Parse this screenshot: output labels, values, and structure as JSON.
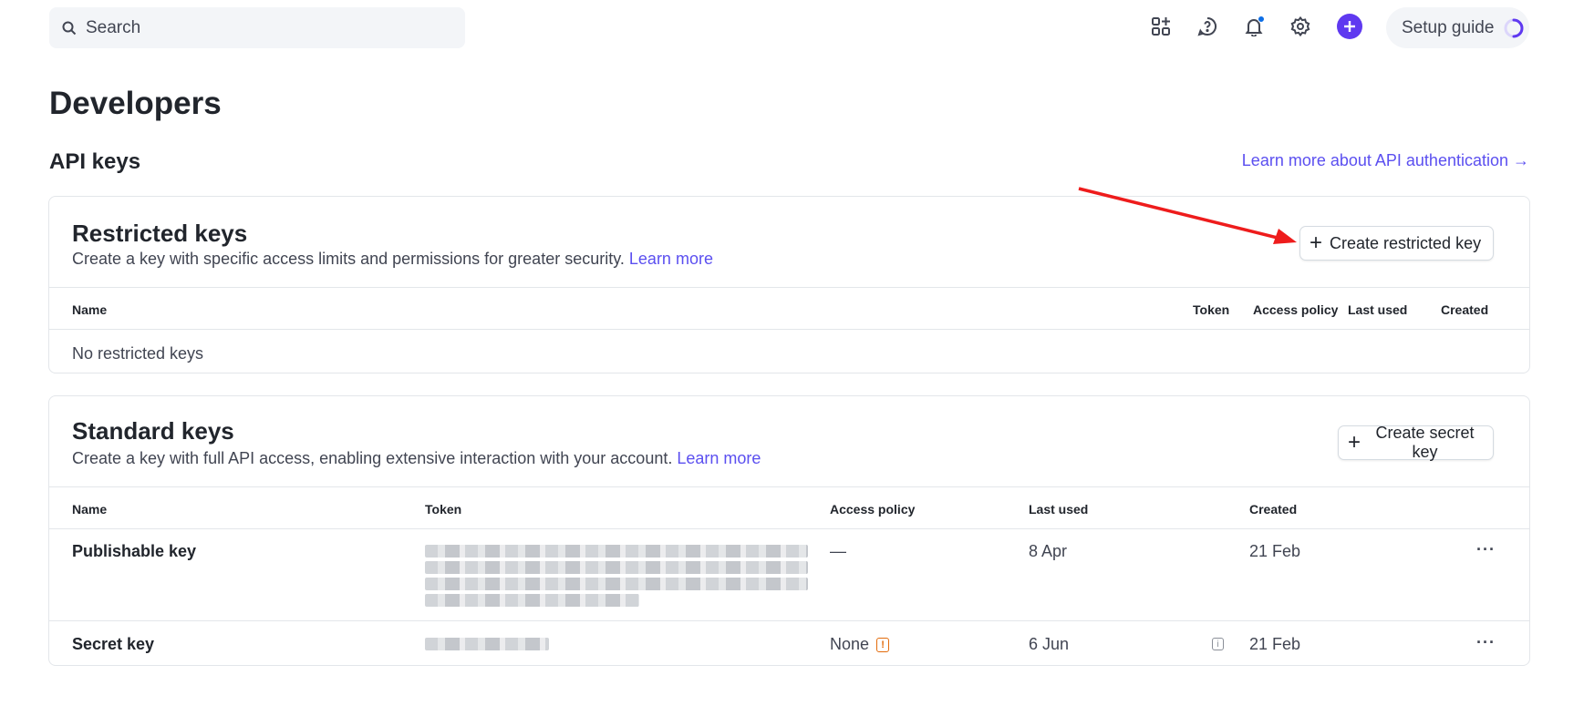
{
  "search": {
    "placeholder": "Search"
  },
  "topbar": {
    "icons": [
      "apps-icon",
      "help-icon",
      "notifications-icon",
      "settings-icon",
      "create-plus-icon"
    ],
    "setup_guide_label": "Setup guide",
    "accent": "#5f39f0"
  },
  "page": {
    "title": "Developers",
    "section_title": "API keys",
    "learn_more_auth": "Learn more about API authentication →"
  },
  "restricted": {
    "title": "Restricted keys",
    "description": "Create a key with specific access limits and permissions for greater security.",
    "learn_more": "Learn more",
    "create_button": "Create restricted key",
    "columns": [
      "Name",
      "Token",
      "Access policy",
      "Last used",
      "Created"
    ],
    "empty_text": "No restricted keys"
  },
  "standard": {
    "title": "Standard keys",
    "description": "Create a key with full API access, enabling extensive interaction with your account.",
    "learn_more": "Learn more",
    "create_button": "Create secret key",
    "columns": [
      "Name",
      "Token",
      "Access policy",
      "Last used",
      "Created"
    ],
    "rows": [
      {
        "name": "Publishable key",
        "access_policy": "—",
        "last_used": "8 Apr",
        "created": "21 Feb",
        "more": "···"
      },
      {
        "name": "Secret key",
        "access_policy": "None",
        "last_used": "6 Jun",
        "created": "21 Feb",
        "more": "···"
      }
    ]
  },
  "colors": {
    "link": "#5b4ff0",
    "warning": "#e36b0b",
    "annotation_arrow": "#ee1c1c"
  }
}
